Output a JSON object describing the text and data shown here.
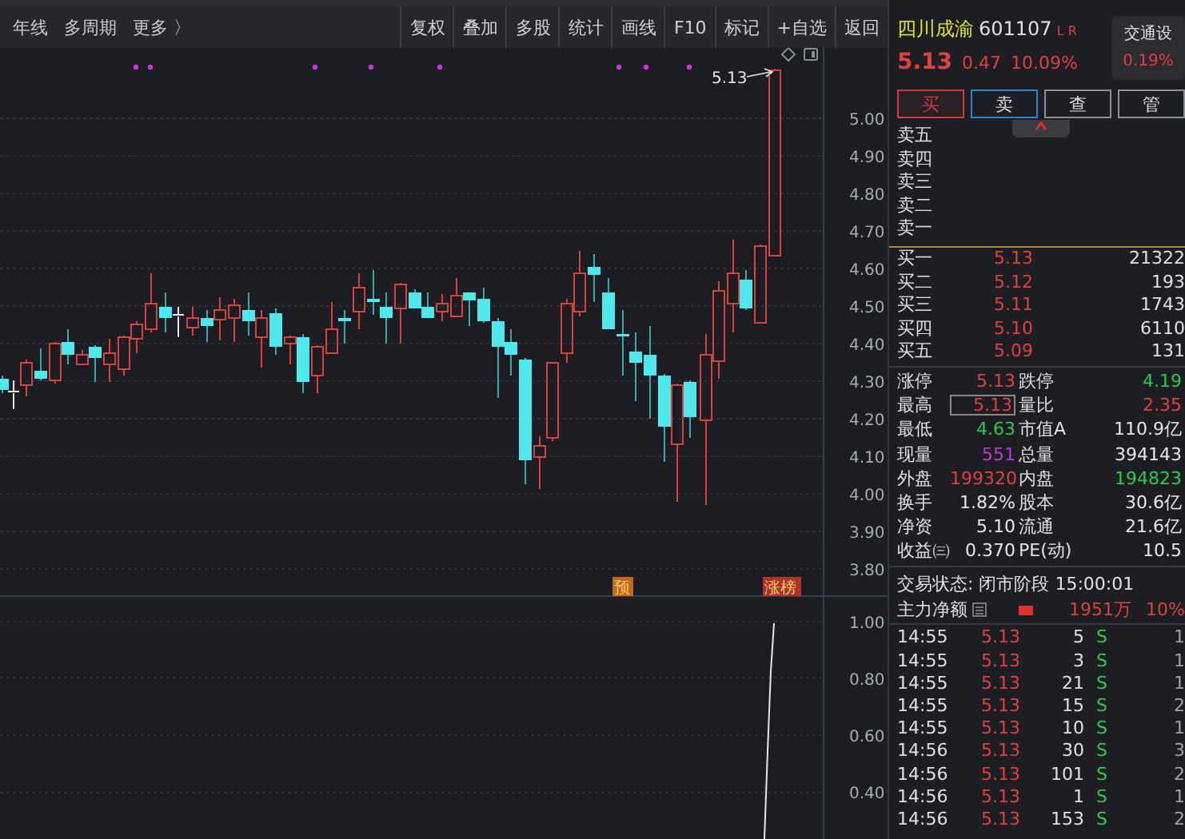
{
  "toolbar": {
    "left_items": [
      "年线",
      "多周期",
      "更多 〉"
    ],
    "right_items": [
      "复权",
      "叠加",
      "多股",
      "统计",
      "画线",
      "F10",
      "标记",
      "+自选",
      "返回"
    ]
  },
  "price_chart": {
    "last_price_label": "5.13",
    "axis_labels": [
      "5.00",
      "4.90",
      "4.80",
      "4.70",
      "4.60",
      "4.50",
      "4.40",
      "4.30",
      "4.20",
      "4.10",
      "4.00",
      "3.90",
      "3.80"
    ],
    "badges": [
      {
        "kind": "forecast",
        "label": "预"
      },
      {
        "kind": "limit",
        "label": "涨榜"
      }
    ]
  },
  "indicator_chart": {
    "axis_labels": [
      "1.00",
      "0.80",
      "0.60",
      "0.40"
    ]
  },
  "quote": {
    "name": "四川成渝",
    "code": "601107",
    "flags": "L R",
    "price": "5.13",
    "change": "0.47",
    "change_pct": "10.09%",
    "sector": {
      "name": "交通设",
      "change_pct": "0.19%"
    },
    "trade_buttons": [
      {
        "label": "买",
        "selected": true,
        "color": "#d23a3a"
      },
      {
        "label": "卖",
        "selected": false,
        "color": "#2f82d0"
      },
      {
        "label": "查",
        "selected": false,
        "color": "#8a8d94"
      },
      {
        "label": "管",
        "selected": false,
        "color": "#8a8d94"
      }
    ],
    "sell_levels": [
      {
        "label": "卖五"
      },
      {
        "label": "卖四"
      },
      {
        "label": "卖三"
      },
      {
        "label": "卖二"
      },
      {
        "label": "卖一"
      }
    ],
    "buy_levels": [
      {
        "label": "买一",
        "price": "5.13",
        "volume": "21322"
      },
      {
        "label": "买二",
        "price": "5.12",
        "volume": "193"
      },
      {
        "label": "买三",
        "price": "5.11",
        "volume": "1743"
      },
      {
        "label": "买四",
        "price": "5.10",
        "volume": "6110"
      },
      {
        "label": "买五",
        "price": "5.09",
        "volume": "131"
      }
    ],
    "stats": [
      {
        "label": "涨停",
        "value": "5.13",
        "color": "#e0403c",
        "boxed": false
      },
      {
        "label": "跌停",
        "value": "4.19",
        "color": "#2fc84a",
        "boxed": false
      },
      {
        "label": "最高",
        "value": "5.13",
        "color": "#e0403c",
        "boxed": true
      },
      {
        "label": "量比",
        "value": "2.35",
        "color": "#e0403c",
        "boxed": false
      },
      {
        "label": "最低",
        "value": "4.63",
        "color": "#2fc84a",
        "boxed": false
      },
      {
        "label": "市值A",
        "value": "110.9亿",
        "color": "#e6e6e6",
        "boxed": false
      },
      {
        "label": "现量",
        "value": "551",
        "color": "#b040d0",
        "boxed": false
      },
      {
        "label": "总量",
        "value": "394143",
        "color": "#e6e6e6",
        "boxed": false
      },
      {
        "label": "外盘",
        "value": "199320",
        "color": "#e0403c",
        "boxed": false
      },
      {
        "label": "内盘",
        "value": "194823",
        "color": "#2fc84a",
        "boxed": false
      },
      {
        "label": "换手",
        "value": "1.82%",
        "color": "#e6e6e6",
        "boxed": false
      },
      {
        "label": "股本",
        "value": "30.6亿",
        "color": "#e6e6e6",
        "boxed": false
      },
      {
        "label": "净资",
        "value": "5.10",
        "color": "#e6e6e6",
        "boxed": false
      },
      {
        "label": "流通",
        "value": "21.6亿",
        "color": "#e6e6e6",
        "boxed": false
      },
      {
        "label": "收益㈢",
        "value": "0.370",
        "color": "#e6e6e6",
        "boxed": false
      },
      {
        "label": "PE(动)",
        "value": "10.5",
        "color": "#e6e6e6",
        "boxed": false
      }
    ],
    "trade_status": "交易状态: 闭市阶段 15:00:01",
    "main_force": {
      "label": "主力净额",
      "amount": "1951万",
      "pct": "10%"
    },
    "ticks": [
      {
        "time": "14:55",
        "price": "5.13",
        "volume": "5",
        "side": "S",
        "column_5": "1"
      },
      {
        "time": "14:55",
        "price": "5.13",
        "volume": "3",
        "side": "S",
        "column_5": "1"
      },
      {
        "time": "14:55",
        "price": "5.13",
        "volume": "21",
        "side": "S",
        "column_5": "1"
      },
      {
        "time": "14:55",
        "price": "5.13",
        "volume": "15",
        "side": "S",
        "column_5": "2"
      },
      {
        "time": "14:55",
        "price": "5.13",
        "volume": "10",
        "side": "S",
        "column_5": "1"
      },
      {
        "time": "14:56",
        "price": "5.13",
        "volume": "30",
        "side": "S",
        "column_5": "3"
      },
      {
        "time": "14:56",
        "price": "5.13",
        "volume": "101",
        "side": "S",
        "column_5": "2"
      },
      {
        "time": "14:56",
        "price": "5.13",
        "volume": "1",
        "side": "S",
        "column_5": "1"
      },
      {
        "time": "14:56",
        "price": "5.13",
        "volume": "153",
        "side": "S",
        "column_5": "2"
      }
    ]
  }
}
